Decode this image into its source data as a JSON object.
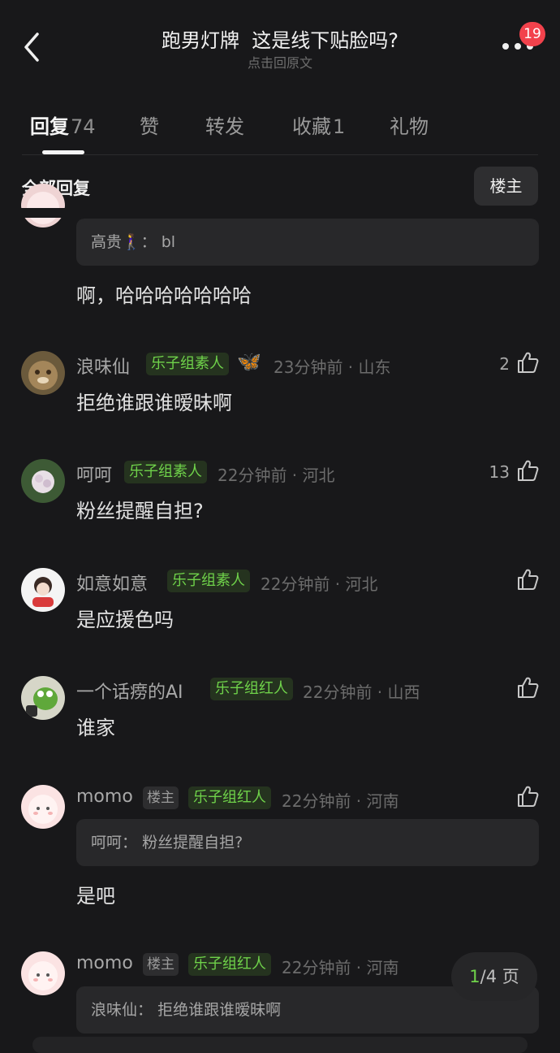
{
  "header": {
    "title": "跑男灯牌  这是线下贴脸吗?",
    "subtitle": "点击回原文",
    "notification_count": "19"
  },
  "tabs": [
    {
      "label": "回复",
      "count": "74",
      "active": true
    },
    {
      "label": "赞",
      "count": ""
    },
    {
      "label": "转发",
      "count": ""
    },
    {
      "label": "收藏",
      "count": "1"
    },
    {
      "label": "礼物",
      "count": ""
    }
  ],
  "filter": {
    "all_label": "全部回复",
    "op_button": "楼主"
  },
  "comments": [
    {
      "quote_user": "高贵🚶‍♀️",
      "quote_text": "bl",
      "text": "啊，哈哈哈哈哈哈哈"
    },
    {
      "name": "浪味仙",
      "tag": "乐子组素人",
      "emoji": "🦋",
      "time": "23分钟前 · 山东",
      "likes": "2",
      "text": "拒绝谁跟谁暧昧啊"
    },
    {
      "name": "呵呵",
      "tag": "乐子组素人",
      "time": "22分钟前 · 河北",
      "likes": "13",
      "text": "粉丝提醒自担?"
    },
    {
      "name": "如意如意",
      "tag": "乐子组素人",
      "time": "22分钟前 · 河北",
      "likes": "",
      "text": "是应援色吗"
    },
    {
      "name": "一个话痨的AI",
      "tag": "乐子组红人",
      "time": "22分钟前 · 山西",
      "likes": "",
      "text": "谁家"
    },
    {
      "name": "momo",
      "op_tag": "楼主",
      "tag": "乐子组红人",
      "time": "22分钟前 · 河南",
      "likes": "",
      "quote_user": "呵呵",
      "quote_text": "粉丝提醒自担?",
      "text": "是吧"
    },
    {
      "name": "momo",
      "op_tag": "楼主",
      "tag": "乐子组红人",
      "time": "22分钟前 · 河南",
      "likes": "",
      "quote_user": "浪味仙",
      "quote_text": "拒绝谁跟谁暧昧啊"
    }
  ],
  "pager": {
    "current": "1",
    "rest": "/4 页"
  },
  "colors": {
    "background": "#18181a",
    "tag_green": "#6fd24a",
    "badge_red": "#f2424c"
  }
}
